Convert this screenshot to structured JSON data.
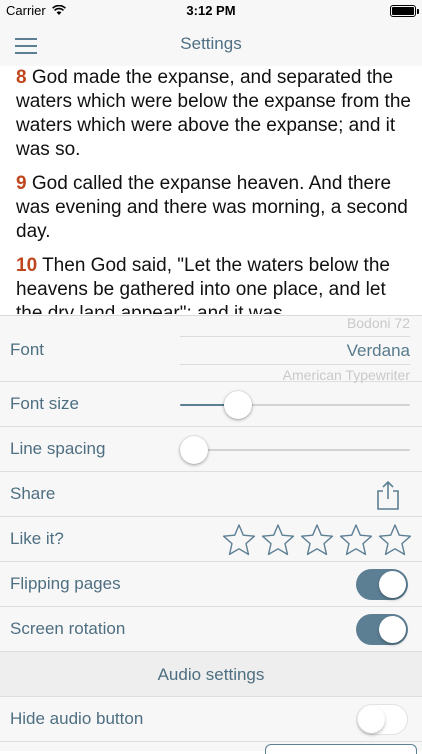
{
  "status_bar": {
    "carrier": "Carrier",
    "time": "3:12 PM"
  },
  "nav": {
    "title": "Settings"
  },
  "scripture": {
    "verses": [
      {
        "number": "8",
        "text": " God made the expanse, and separated the waters which were below the expanse from the waters which were above the expanse; and it was so."
      },
      {
        "number": "9",
        "text": " God called the expanse heaven. And there was evening and there was morning, a second day."
      },
      {
        "number": "10",
        "text": " Then God said, \"Let the waters below the heavens be gathered into one place, and let the dry land appear\"; and it was"
      }
    ]
  },
  "settings": {
    "font": {
      "label": "Font",
      "options": [
        "Bodoni 72",
        "Verdana",
        "American Typewriter"
      ],
      "selected": "Verdana"
    },
    "font_size": {
      "label": "Font size",
      "value": 0.25
    },
    "line_spacing": {
      "label": "Line spacing",
      "value": 0.06
    },
    "share": {
      "label": "Share",
      "icon": "share-icon"
    },
    "like": {
      "label": "Like it?",
      "stars": 5,
      "rating": 0
    },
    "flipping_pages": {
      "label": "Flipping pages",
      "on": true
    },
    "screen_rotation": {
      "label": "Screen rotation",
      "on": true
    },
    "audio_header": "Audio settings",
    "hide_audio": {
      "label": "Hide audio button",
      "on": false
    }
  },
  "colors": {
    "accent": "#5d7f94",
    "verse_number": "#c0461e",
    "panel": "#f7f7f7"
  }
}
